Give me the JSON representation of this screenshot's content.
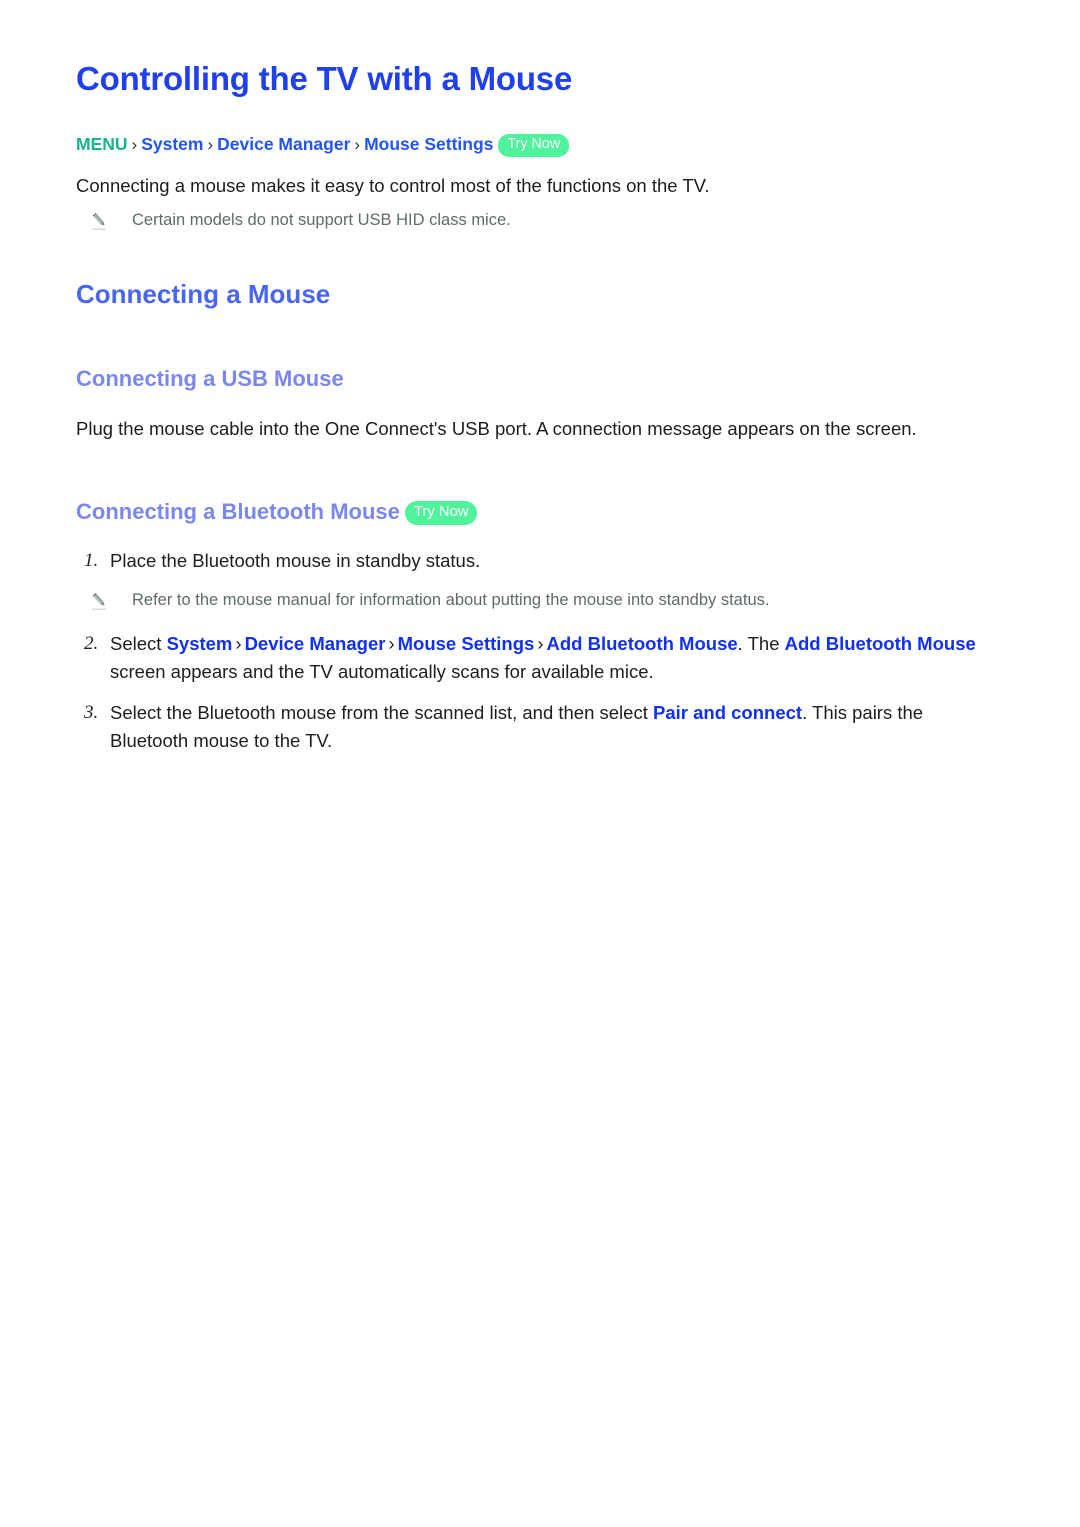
{
  "document": {
    "title": "Controlling the TV with a Mouse"
  },
  "breadcrumb": {
    "menu_label": "MENU",
    "separator": "›",
    "items": [
      {
        "label": "System"
      },
      {
        "label": "Device Manager"
      },
      {
        "label": "Mouse Settings"
      }
    ],
    "try_now_label": "Try Now"
  },
  "intro": {
    "paragraph": "Connecting a mouse makes it easy to control most of the functions on the TV.",
    "note": {
      "icon": "pencil-icon",
      "text": "Certain models do not support USB HID class mice."
    }
  },
  "sections": {
    "connecting_a_mouse": {
      "heading": "Connecting a Mouse"
    },
    "usb": {
      "heading": "Connecting a USB Mouse",
      "paragraph": "Plug the mouse cable into the One Connect's USB port. A connection message appears on the screen."
    },
    "bluetooth": {
      "heading": "Connecting a Bluetooth Mouse",
      "try_now_label": "Try Now",
      "steps": [
        {
          "number": "1.",
          "parts": [
            {
              "type": "text",
              "value": "Place the Bluetooth mouse in standby status."
            }
          ],
          "note": {
            "icon": "pencil-icon",
            "text": "Refer to the mouse manual for information about putting the mouse into standby status."
          }
        },
        {
          "number": "2.",
          "parts": [
            {
              "type": "text",
              "value": "Select "
            },
            {
              "type": "link",
              "value": "System"
            },
            {
              "type": "sep",
              "value": "›"
            },
            {
              "type": "link",
              "value": "Device Manager"
            },
            {
              "type": "sep",
              "value": "›"
            },
            {
              "type": "link",
              "value": "Mouse Settings"
            },
            {
              "type": "sep",
              "value": "›"
            },
            {
              "type": "link",
              "value": "Add Bluetooth Mouse"
            },
            {
              "type": "text",
              "value": ". The "
            },
            {
              "type": "link",
              "value": "Add Bluetooth Mouse"
            },
            {
              "type": "text",
              "value": " screen appears and the TV automatically scans for available mice."
            }
          ]
        },
        {
          "number": "3.",
          "parts": [
            {
              "type": "text",
              "value": "Select the Bluetooth mouse from the scanned list, and then select "
            },
            {
              "type": "link",
              "value": "Pair and connect"
            },
            {
              "type": "text",
              "value": ". This pairs the Bluetooth mouse to the TV."
            }
          ]
        }
      ]
    }
  },
  "colors": {
    "title_blue": "#2040f0",
    "heading_blue": "#4a64f5",
    "subheading_blue": "#7b87ee",
    "link_blue": "#1030f5",
    "menu_teal": "#15b48c",
    "badge_green": "#4ef39c",
    "note_gray": "#5f6b6b",
    "body_text": "#1d1d1d"
  }
}
